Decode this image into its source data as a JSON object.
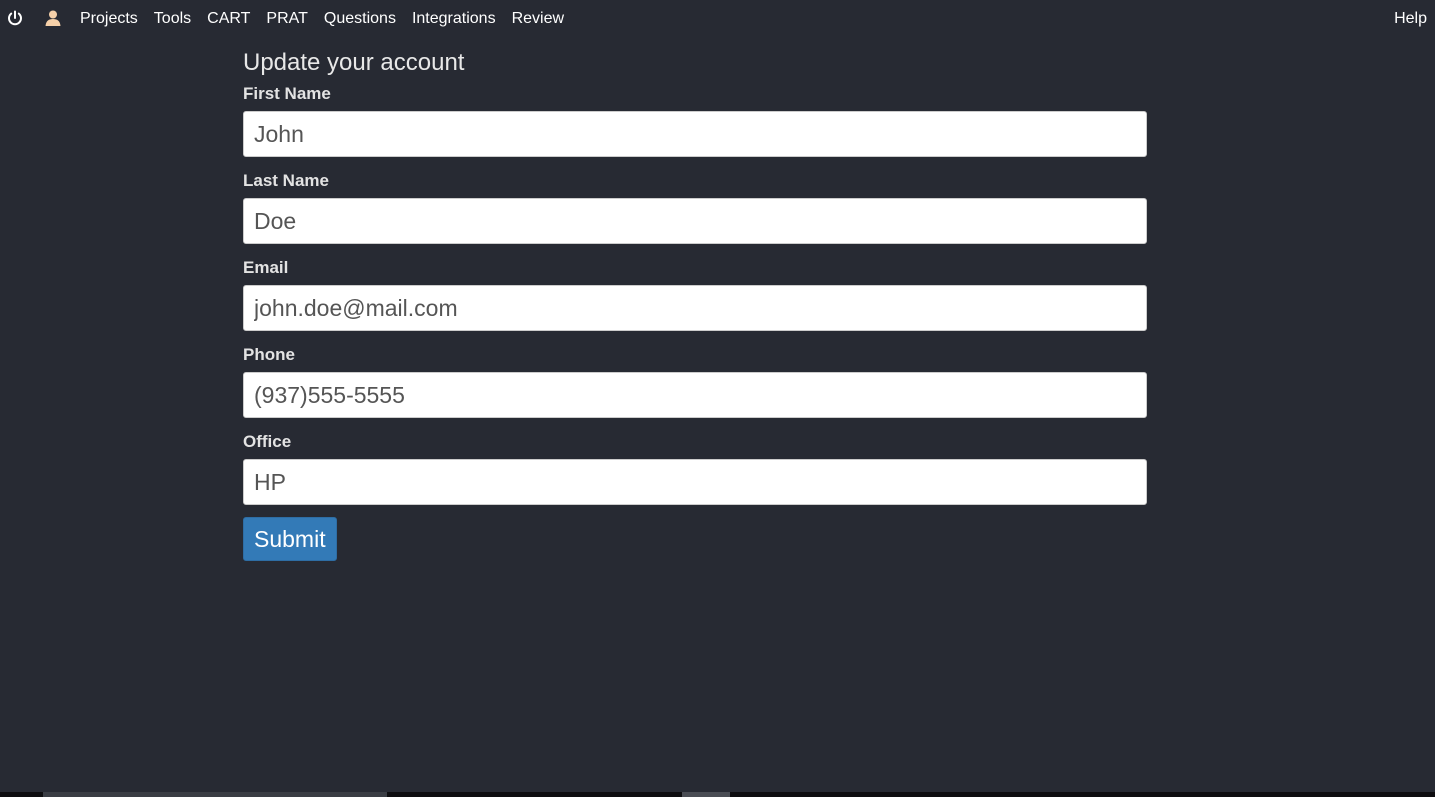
{
  "nav": {
    "power_icon": "power-icon",
    "user_icon": "user-icon",
    "links": [
      "Projects",
      "Tools",
      "CART",
      "PRAT",
      "Questions",
      "Integrations",
      "Review"
    ],
    "help": "Help"
  },
  "form": {
    "title": "Update your account",
    "first_name": {
      "label": "First Name",
      "value": "John"
    },
    "last_name": {
      "label": "Last Name",
      "value": "Doe"
    },
    "email": {
      "label": "Email",
      "value": "john.doe@mail.com"
    },
    "phone": {
      "label": "Phone",
      "value": "(937)555-5555"
    },
    "office": {
      "label": "Office",
      "value": "HP"
    },
    "submit_label": "Submit"
  },
  "colors": {
    "background": "#272a33",
    "submit": "#337ab7",
    "user_icon": "#f5d0a9"
  }
}
